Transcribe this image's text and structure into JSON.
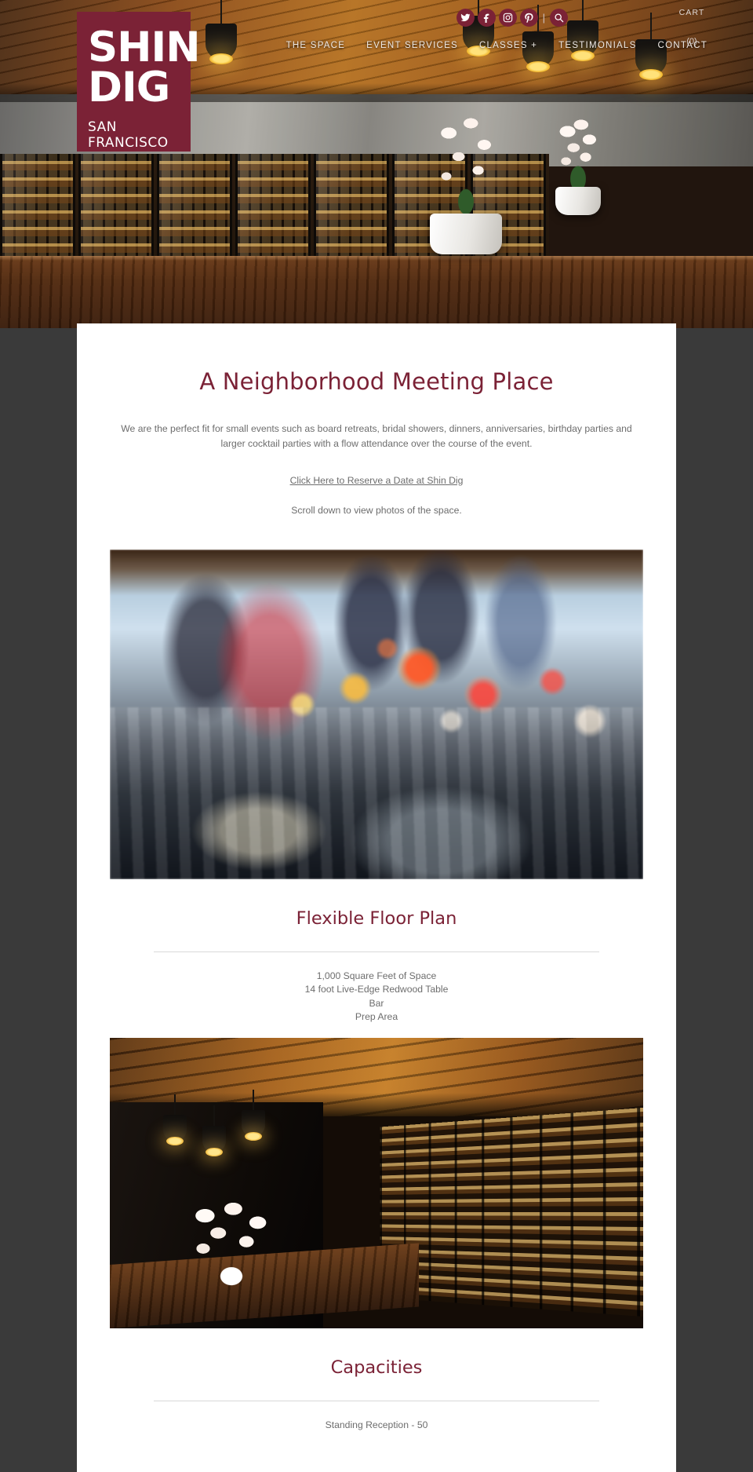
{
  "brand": {
    "line1": "SHIN",
    "line2": "DIG",
    "line3": "SAN FRANCISCO"
  },
  "header": {
    "social": [
      {
        "name": "twitter-icon",
        "label": "Twitter"
      },
      {
        "name": "facebook-icon",
        "label": "Facebook"
      },
      {
        "name": "instagram-icon",
        "label": "Instagram"
      },
      {
        "name": "pinterest-icon",
        "label": "Pinterest"
      },
      {
        "name": "search-icon",
        "label": "Search"
      }
    ],
    "divider": "|",
    "cart_label": "CART",
    "cart_count": "(0)",
    "menu": [
      {
        "label": "THE SPACE"
      },
      {
        "label": "EVENT SERVICES"
      },
      {
        "label": "CLASSES +"
      },
      {
        "label": "TESTIMONIALS"
      },
      {
        "label": "CONTACT"
      }
    ]
  },
  "main": {
    "title": "A Neighborhood Meeting Place",
    "intro": "We are the perfect fit for small events such as board retreats, bridal showers, dinners, anniversaries, birthday parties and larger cocktail parties with a flow attendance over the course of the event.",
    "reserve_link": "Click Here to Reserve a Date at Shin Dig",
    "scroll_note": "Scroll down to view photos of the space.",
    "sections": [
      {
        "heading": "Flexible Floor Plan",
        "specs": [
          "1,000 Square Feet of Space",
          "14 foot Live-Edge Redwood Table",
          "Bar",
          "Prep Area"
        ]
      },
      {
        "heading": "Capacities",
        "specs": [
          "Standing Reception - 50"
        ]
      }
    ]
  },
  "colors": {
    "brand_maroon": "#7b2236",
    "body_text": "#6d6d6d",
    "panel_bg": "#ffffff",
    "page_bg": "#3a3a3a",
    "rule": "#d9d9d9"
  }
}
